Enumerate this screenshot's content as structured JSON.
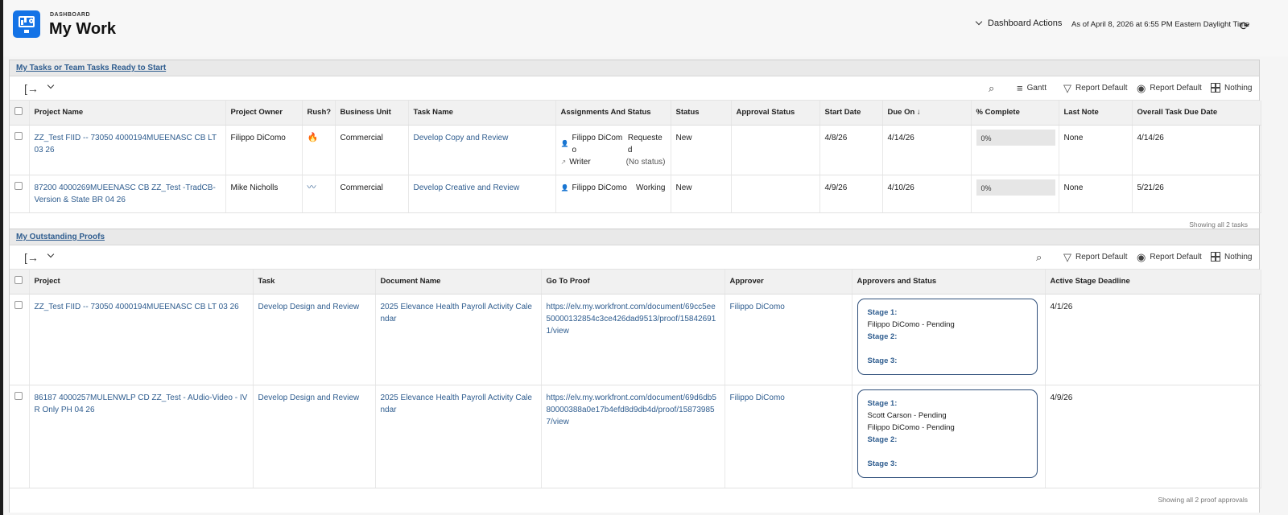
{
  "header": {
    "eyebrow": "DASHBOARD",
    "title": "My Work",
    "actions_label": "Dashboard Actions",
    "as_of": "As of April 8, 2026 at 6:55 PM Eastern Daylight Time"
  },
  "tasks": {
    "title": "My Tasks or Team Tasks Ready to Start",
    "toolbar": {
      "gantt": "Gantt",
      "filter": "Report Default",
      "view": "Report Default",
      "group": "Nothing"
    },
    "columns": [
      "Project Name",
      "Project Owner",
      "Rush?",
      "Business Unit",
      "Task Name",
      "Assignments And Status",
      "Status",
      "Approval Status",
      "Start Date",
      "Due On ↓",
      "% Complete",
      "Last Note",
      "Overall Task Due Date"
    ],
    "rows": [
      {
        "project": "ZZ_Test FIID -- 73050 4000194MUEENASC CB LT 03 26",
        "owner": "Filippo DiComo",
        "rush_icon": "fire-icon",
        "unit": "Commercial",
        "task": "Develop Copy and Review",
        "assign1_name": "Filippo DiComo",
        "assign1_status": "Requested",
        "assign2_name": "Writer",
        "assign2_status": "(No status)",
        "status": "New",
        "approval": "",
        "start": "4/8/26",
        "due": "4/14/26",
        "pct": "0%",
        "note": "None",
        "overall_due": "4/14/26"
      },
      {
        "project": "87200 4000269MUEENASC CB ZZ_Test -TradCB-Version & State BR 04 26",
        "owner": "Mike Nicholls",
        "rush_icon": "wave-icon",
        "unit": "Commercial",
        "task": "Develop Creative and Review",
        "assign1_name": "Filippo DiComo",
        "assign1_status": "Working",
        "status": "New",
        "approval": "",
        "start": "4/9/26",
        "due": "4/10/26",
        "pct": "0%",
        "note": "None",
        "overall_due": "5/21/26"
      }
    ],
    "footer": "Showing all 2 tasks"
  },
  "proofs": {
    "title": "My Outstanding Proofs",
    "toolbar": {
      "filter": "Report Default",
      "view": "Report Default",
      "group": "Nothing"
    },
    "columns": [
      "Project",
      "Task",
      "Document Name",
      "Go To Proof",
      "Approver",
      "Approvers and Status",
      "Active Stage Deadline"
    ],
    "rows": [
      {
        "project": "ZZ_Test FIID -- 73050 4000194MUEENASC CB LT 03 26",
        "task": "Develop Design and Review",
        "document": "2025 Elevance Health Payroll Activity Calendar",
        "proof_url": "https://elv.my.workfront.com/document/69cc5ee50000132854c3ce426dad9513/proof/158426911/view",
        "approver": "Filippo DiComo",
        "stage1": "Stage 1:",
        "stage1_people": [
          "Filippo DiComo - Pending"
        ],
        "stage2": "Stage 2:",
        "stage3": "Stage 3:",
        "deadline": "4/1/26"
      },
      {
        "project": "86187 4000257MULENWLP CD ZZ_Test - AUdio-Video - IVR Only PH 04 26",
        "task": "Develop Design and Review",
        "document": "2025 Elevance Health Payroll Activity Calendar",
        "proof_url": "https://elv.my.workfront.com/document/69d6db580000388a0e17b4efd8d9db4d/proof/158739857/view",
        "approver": "Filippo DiComo",
        "stage1": "Stage 1:",
        "stage1_people": [
          "Scott Carson - Pending",
          "Filippo DiComo - Pending"
        ],
        "stage2": "Stage 2:",
        "stage3": "Stage 3:",
        "deadline": "4/9/26"
      }
    ],
    "footer": "Showing all 2 proof approvals"
  },
  "colors": {
    "brand": "#1473e6",
    "link": "#2f5d8f",
    "stage_border": "#2f4f7a",
    "rush": "#e37a1d"
  }
}
